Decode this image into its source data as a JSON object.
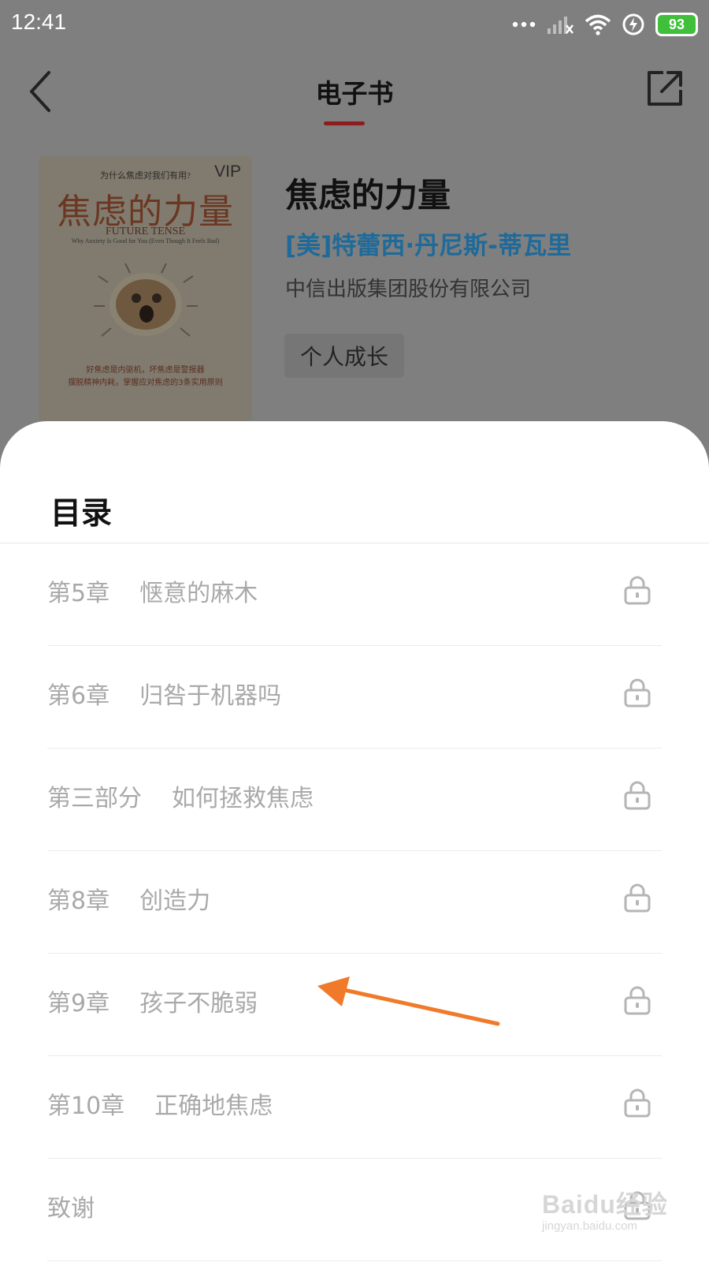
{
  "status_bar": {
    "time": "12:41",
    "battery": "93",
    "icons": [
      "more-dots-icon",
      "signal-off-icon",
      "wifi-icon",
      "charging-icon",
      "battery-icon"
    ]
  },
  "nav": {
    "title": "电子书",
    "back_icon": "chevron-left-icon",
    "share_icon": "share-icon",
    "accent_color": "#c0282d"
  },
  "book": {
    "title": "焦虑的力量",
    "author": "[美]特蕾西·丹尼斯-蒂瓦里",
    "publisher": "中信出版集团股份有限公司",
    "tag": "个人成长",
    "author_color": "#2a8fd6",
    "cover": {
      "subtitle": "为什么焦虑对我们有用?",
      "badge": "VIP",
      "title": "焦虑的力量",
      "english_title": "FUTURE TENSE",
      "english_subtitle": "Why Anxiety Is Good for You (Even Though It Feels Bad)",
      "tagline_1": "好焦虑是内驱机，坏焦虑是警报器",
      "tagline_2": "摆脱精神内耗，掌握应对焦虑的3条实用原则"
    }
  },
  "toc": {
    "title": "目录",
    "items": [
      {
        "number": "第5章",
        "name": "惬意的麻木"
      },
      {
        "number": "第6章",
        "name": "归咎于机器吗"
      },
      {
        "number": "第三部分",
        "name": "如何拯救焦虑"
      },
      {
        "number": "第8章",
        "name": "创造力"
      },
      {
        "number": "第9章",
        "name": "孩子不脆弱"
      },
      {
        "number": "第10章",
        "name": "正确地焦虑"
      },
      {
        "number": "致谢",
        "name": ""
      }
    ],
    "lock_icon": "lock-icon"
  },
  "annotation": {
    "arrow_color": "#f07a2a",
    "points_to": "第9章"
  },
  "watermark": {
    "main": "Baidu经验",
    "sub": "jingyan.baidu.com"
  }
}
